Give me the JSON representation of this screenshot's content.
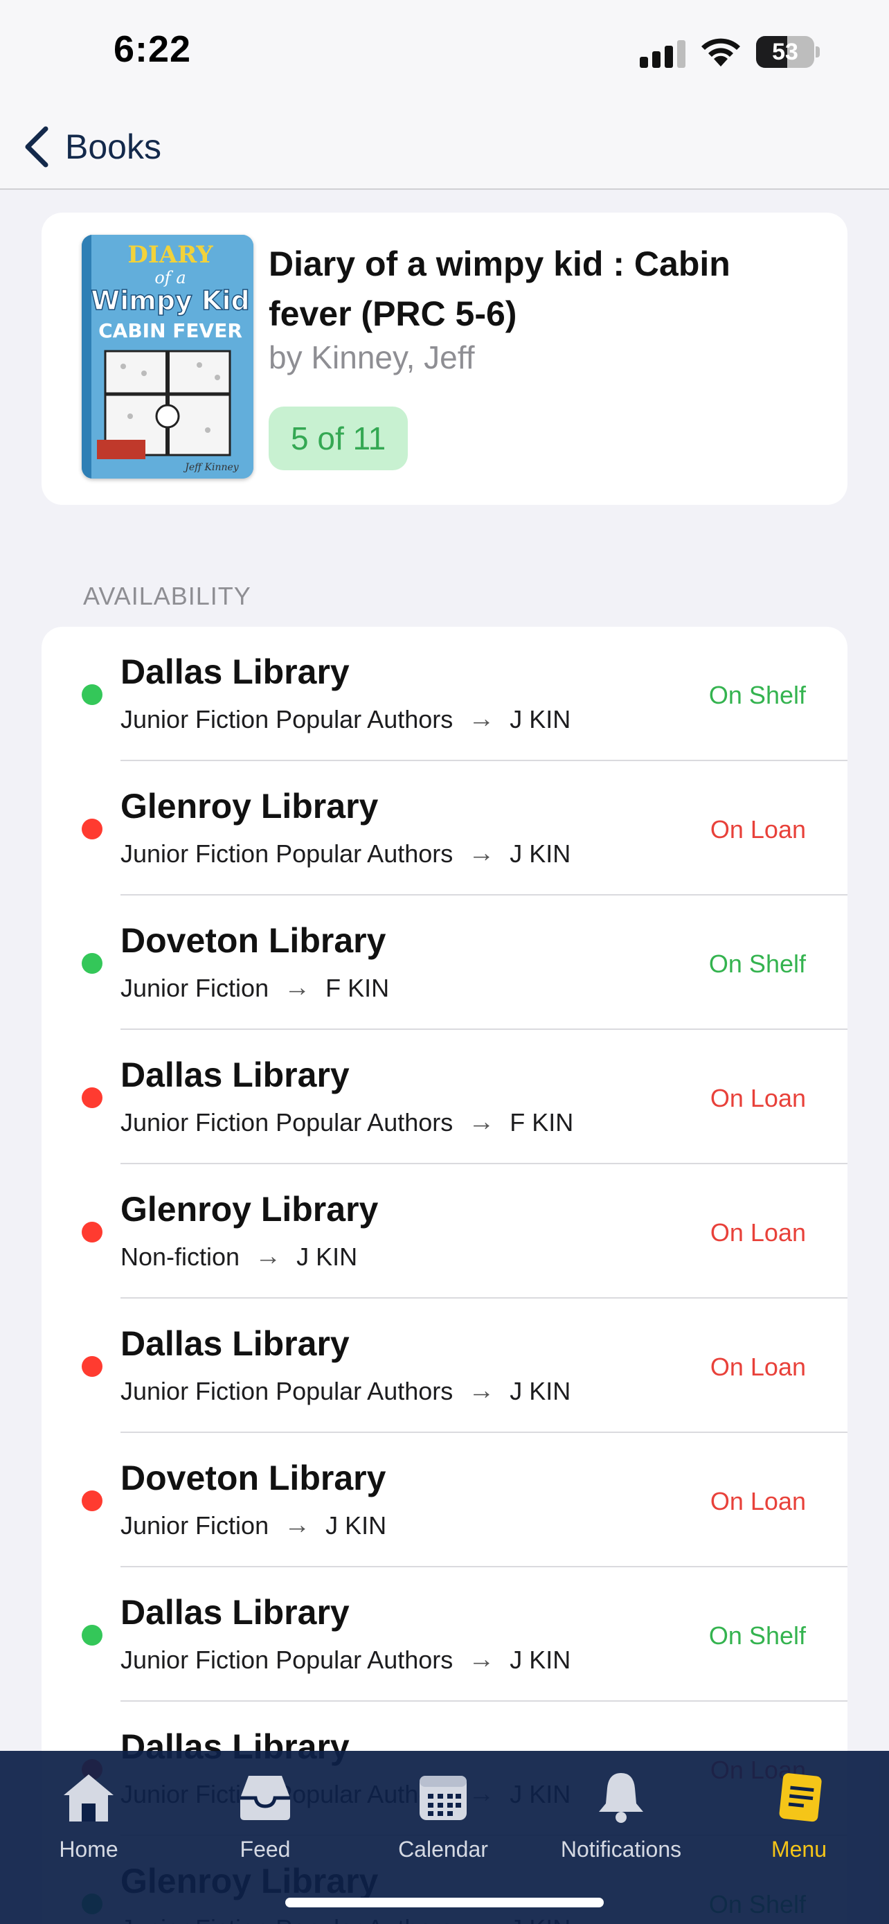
{
  "status_bar": {
    "time": "6:22",
    "battery": "53",
    "battery_level": 0.53
  },
  "nav": {
    "back_label": "Books"
  },
  "book": {
    "cover_text": {
      "line1": "DIARY",
      "line2": "of a",
      "line3": "Wimpy Kid",
      "line4": "CABIN FEVER",
      "author_sig": "Jeff Kinney"
    },
    "title": "Diary of a wimpy kid : Cabin fever (PRC 5-6)",
    "author": "by Kinney, Jeff",
    "availability_count": "5 of 11"
  },
  "section_header": "AVAILABILITY",
  "colors": {
    "on_shelf": "#34c759",
    "on_loan": "#ff3b30",
    "on_shelf_text": "#34b34f",
    "on_loan_text": "#e8413a",
    "accent": "#f5c518",
    "nav": "#13294b"
  },
  "holdings": [
    {
      "library": "Dallas Library",
      "collection": "Junior Fiction Popular Authors",
      "call_number": "J KIN",
      "status": "On Shelf"
    },
    {
      "library": "Glenroy Library",
      "collection": "Junior Fiction Popular Authors",
      "call_number": "J KIN",
      "status": "On Loan"
    },
    {
      "library": "Doveton Library",
      "collection": "Junior Fiction",
      "call_number": "F KIN",
      "status": "On Shelf"
    },
    {
      "library": "Dallas Library",
      "collection": "Junior Fiction Popular Authors",
      "call_number": "F KIN",
      "status": "On Loan"
    },
    {
      "library": "Glenroy Library",
      "collection": "Non-fiction",
      "call_number": "J KIN",
      "status": "On Loan"
    },
    {
      "library": "Dallas Library",
      "collection": "Junior Fiction Popular Authors",
      "call_number": "J KIN",
      "status": "On Loan"
    },
    {
      "library": "Doveton Library",
      "collection": "Junior Fiction",
      "call_number": "J KIN",
      "status": "On Loan"
    },
    {
      "library": "Dallas Library",
      "collection": "Junior Fiction Popular Authors",
      "call_number": "J KIN",
      "status": "On Shelf"
    },
    {
      "library": "Dallas Library",
      "collection": "Junior Fiction Popular Authors",
      "call_number": "J KIN",
      "status": "On Loan"
    },
    {
      "library": "Glenroy Library",
      "collection": "Junior Fiction Popular Authors",
      "call_number": "J KIN",
      "status": "On Shelf"
    }
  ],
  "tabs": [
    {
      "label": "Home",
      "icon": "home-icon",
      "active": false
    },
    {
      "label": "Feed",
      "icon": "inbox-icon",
      "active": false
    },
    {
      "label": "Calendar",
      "icon": "calendar-icon",
      "active": false
    },
    {
      "label": "Notifications",
      "icon": "bell-icon",
      "active": false
    },
    {
      "label": "Menu",
      "icon": "menu-card-icon",
      "active": true
    }
  ]
}
